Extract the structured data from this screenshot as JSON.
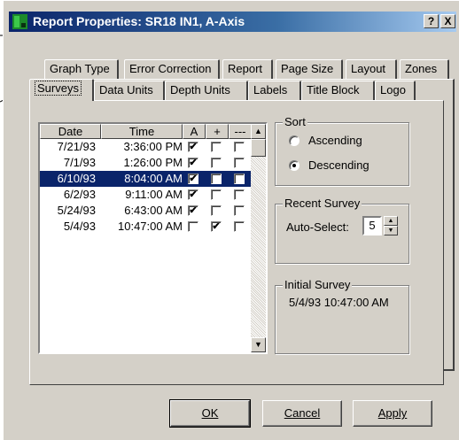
{
  "title": "Report Properties: SR18 IN1, A-Axis",
  "titlebar_buttons": {
    "help": "?",
    "close": "X"
  },
  "tabs_row_back": [
    "Graph Type",
    "Error Correction",
    "Report",
    "Page Size",
    "Layout",
    "Zones"
  ],
  "tabs_row_front": [
    "Surveys",
    "Data Units",
    "Depth Units",
    "Labels",
    "Title Block",
    "Logo"
  ],
  "selected_tab": "Surveys",
  "list": {
    "headers": [
      "Date",
      "Time",
      "A",
      "+",
      "---"
    ],
    "rows": [
      {
        "date": "7/21/93",
        "time": "3:36:00 PM",
        "a": true,
        "plus": false,
        "dash": false,
        "selected": false
      },
      {
        "date": "7/1/93",
        "time": "1:26:00 PM",
        "a": true,
        "plus": false,
        "dash": false,
        "selected": false
      },
      {
        "date": "6/10/93",
        "time": "8:04:00 AM",
        "a": true,
        "plus": false,
        "dash": false,
        "selected": true
      },
      {
        "date": "6/2/93",
        "time": "9:11:00 AM",
        "a": true,
        "plus": false,
        "dash": false,
        "selected": false
      },
      {
        "date": "5/24/93",
        "time": "6:43:00 AM",
        "a": true,
        "plus": false,
        "dash": false,
        "selected": false
      },
      {
        "date": "5/4/93",
        "time": "10:47:00 AM",
        "a": false,
        "plus": true,
        "dash": false,
        "selected": false
      }
    ],
    "check_mark": "✔"
  },
  "sort": {
    "title": "Sort",
    "options": [
      "Ascending",
      "Descending"
    ],
    "selected": "Descending"
  },
  "recent_survey": {
    "title": "Recent Survey",
    "label": "Auto-Select:",
    "value": "5"
  },
  "initial_survey": {
    "title": "Initial Survey",
    "value": "5/4/93 10:47:00 AM"
  },
  "buttons": {
    "ok": "OK",
    "cancel": "Cancel",
    "apply": "Apply"
  },
  "colors": {
    "face": "#d4d0c8",
    "title_start": "#0a246a",
    "selection": "#0a246a"
  }
}
